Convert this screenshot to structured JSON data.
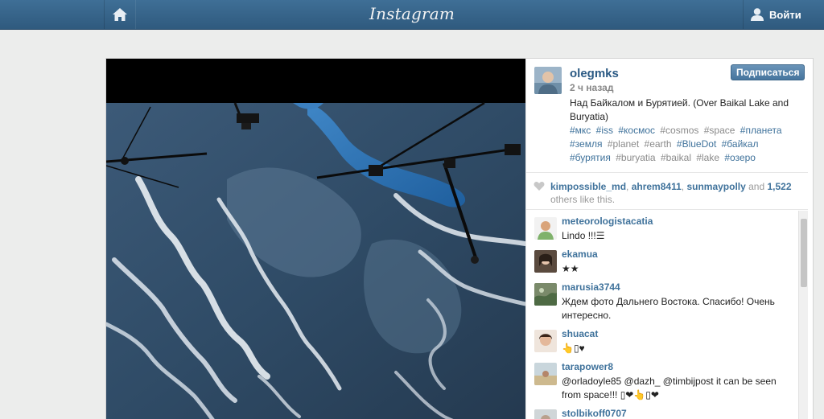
{
  "topbar": {
    "logo": "Instagram",
    "login_label": "Войти"
  },
  "post": {
    "username": "olegmks",
    "time": "2 ч назад",
    "follow_label": "Подписаться",
    "caption": "Над Байкалом и Бурятией. (Over Baikal Lake and Buryatia)",
    "tags": [
      {
        "text": "#мкс",
        "dim": false
      },
      {
        "text": "#iss",
        "dim": false
      },
      {
        "text": "#космос",
        "dim": false
      },
      {
        "text": "#cosmos",
        "dim": true
      },
      {
        "text": "#space",
        "dim": true
      },
      {
        "text": "#планета",
        "dim": false
      },
      {
        "text": "#земля",
        "dim": false
      },
      {
        "text": "#planet",
        "dim": true
      },
      {
        "text": "#earth",
        "dim": true
      },
      {
        "text": "#BlueDot",
        "dim": false
      },
      {
        "text": "#байкал",
        "dim": false
      },
      {
        "text": "#бурятия",
        "dim": false
      },
      {
        "text": "#buryatia",
        "dim": true
      },
      {
        "text": "#baikal",
        "dim": true
      },
      {
        "text": "#lake",
        "dim": true
      },
      {
        "text": "#озеро",
        "dim": false
      }
    ]
  },
  "likes": {
    "user1": "kimpossible_md",
    "sep1": ", ",
    "user2": "ahrem8411",
    "sep2": ", ",
    "user3": "sunmaypolly",
    "and": " and ",
    "count": "1,522",
    "rest": " others like this."
  },
  "comments": [
    {
      "user": "meteorologistacatia",
      "text": "Lindo !!!☰"
    },
    {
      "user": "ekamua",
      "text": "★★"
    },
    {
      "user": "marusia3744",
      "text": "Ждем фото Дальнего Востока. Спасибо! Очень интересно."
    },
    {
      "user": "shuacat",
      "text": "👆▯♥"
    },
    {
      "user": "tarapower8",
      "text": "@orladoyle85 @dazh_ @timbijpost it can be seen from space!!! ▯❤👆▯❤"
    },
    {
      "user": "stolbikoff0707",
      "text": ""
    }
  ],
  "colors": {
    "topbar": "#356286",
    "link": "#3f729b",
    "follow_button": "#517fa4"
  },
  "icons": [
    "home-icon",
    "user-icon",
    "heart-icon"
  ]
}
